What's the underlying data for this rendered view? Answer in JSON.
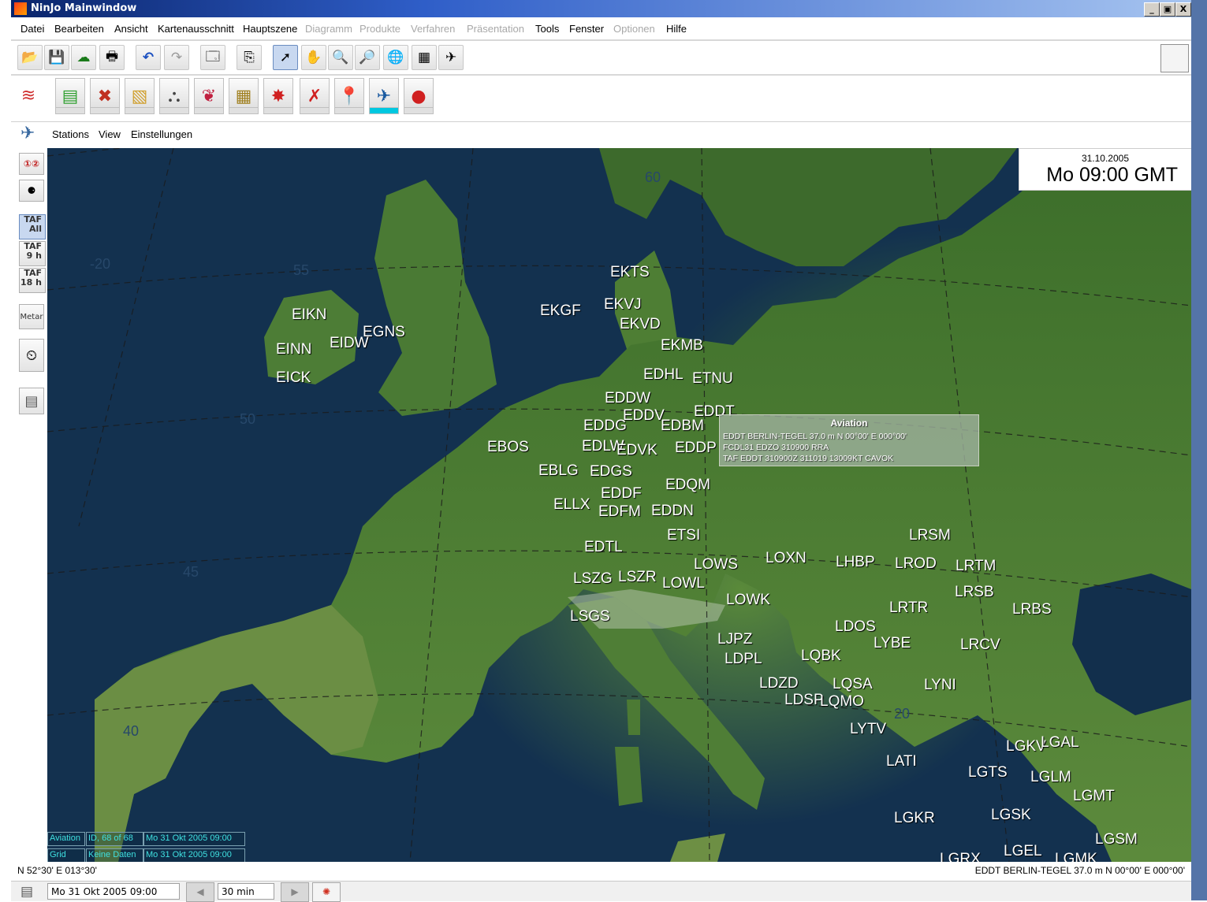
{
  "window": {
    "title": "NinJo Mainwindow",
    "buttons": [
      "_",
      "▣",
      "X"
    ]
  },
  "menubar": [
    {
      "label": "Datei",
      "enabled": true
    },
    {
      "label": "Bearbeiten",
      "enabled": true
    },
    {
      "label": "Ansicht",
      "enabled": true
    },
    {
      "label": "Kartenausschnitt",
      "enabled": true
    },
    {
      "label": "Hauptszene",
      "enabled": true
    },
    {
      "label": "Diagramm",
      "enabled": false
    },
    {
      "label": "Produkte",
      "enabled": false
    },
    {
      "label": "Verfahren",
      "enabled": false
    },
    {
      "label": "Präsentation",
      "enabled": false
    },
    {
      "label": "Tools",
      "enabled": true
    },
    {
      "label": "Fenster",
      "enabled": true
    },
    {
      "label": "Optionen",
      "enabled": false
    },
    {
      "label": "Hilfe",
      "enabled": true
    }
  ],
  "toolbar_icons": [
    "open-folder-icon",
    "save-icon",
    "globe-cloud-icon",
    "print-icon",
    "undo-icon",
    "redo-icon",
    "presentation-icon",
    "export-icon",
    "pointer-icon",
    "hand-pan-icon",
    "zoom-in-icon",
    "zoom-out-icon",
    "globe-icon",
    "grid-icon",
    "airplane-tools-icon"
  ],
  "layer_icons": [
    "layers-icon",
    "chart-layer-icon",
    "cross-layer-icon",
    "field-layer-icon",
    "grid-layer-icon",
    "front-layer-icon",
    "grid-points-icon",
    "red-symbol-icon",
    "wind-icon",
    "red-pin-icon",
    "aviation-icon",
    "red-circle-icon"
  ],
  "station_bar": {
    "menus": [
      "Stations",
      "View",
      "Einstellungen"
    ]
  },
  "left_tools": {
    "taf": [
      {
        "line1": "TAF",
        "line2": "All"
      },
      {
        "line1": "TAF",
        "line2": "9 h"
      },
      {
        "line1": "TAF",
        "line2": "18 h"
      }
    ],
    "metar": "Metar"
  },
  "datetime": {
    "date": "31.10.2005",
    "time": "Mo 09:00 GMT"
  },
  "grid_labels": [
    "60",
    "55",
    "50",
    "45",
    "40",
    "20",
    "-20"
  ],
  "stations": [
    "EKTS",
    "EKGF",
    "EKVJ",
    "EKVD",
    "EIKN",
    "EGNS",
    "EINN",
    "EIDW",
    "EICK",
    "EKMB",
    "EDHL",
    "ETNU",
    "EDDW",
    "EDDV",
    "EDDT",
    "EDDG",
    "EDBM",
    "EBOS",
    "EDLW",
    "EDVK",
    "EDDP",
    "EBLG",
    "EDGS",
    "EDQM",
    "EDDF",
    "ELLX",
    "EDFM",
    "EDDN",
    "ETSI",
    "EDTL",
    "LOWS",
    "LOXN",
    "LHBP",
    "LROD",
    "LRTM",
    "LRSM",
    "LSZG",
    "LSZR",
    "LOWL",
    "LOWK",
    "LSGS",
    "LRSB",
    "LRTR",
    "LRBS",
    "LDOS",
    "LYBE",
    "LJPZ",
    "LDPL",
    "LQBK",
    "LRCV",
    "LDZD",
    "LQSA",
    "LYNI",
    "LDSP",
    "LQMO",
    "LYTV",
    "LATI",
    "LGKV",
    "LGAL",
    "LGTS",
    "LGLM",
    "LGMT",
    "LGKR",
    "LGSK",
    "LGSM",
    "LGEL",
    "LGRX",
    "LGMK"
  ],
  "tooltip": {
    "title": "Aviation",
    "lines": [
      "EDDT BERLIN-TEGEL 37.0 m  N 00°00' E 000°00'",
      "FCDL31 EDZO 310900 RRA",
      "TAF EDDT 310900Z 311019 13009KT CAVOK"
    ]
  },
  "layers": [
    {
      "name": "Aviation",
      "info": "ID, 68 of 68",
      "time": "Mo 31 Okt 2005 09:00"
    },
    {
      "name": "Grid",
      "info": "Keine Daten",
      "time": "Mo 31 Okt 2005 09:00"
    }
  ],
  "status": {
    "coords": "N 52°30' E 013°30'",
    "station_info": "EDDT BERLIN-TEGEL 37.0 m  N 00°00' E 000°00'"
  },
  "bottom": {
    "datetime": "Mo 31 Okt 2005 09:00",
    "step": "30 min"
  }
}
